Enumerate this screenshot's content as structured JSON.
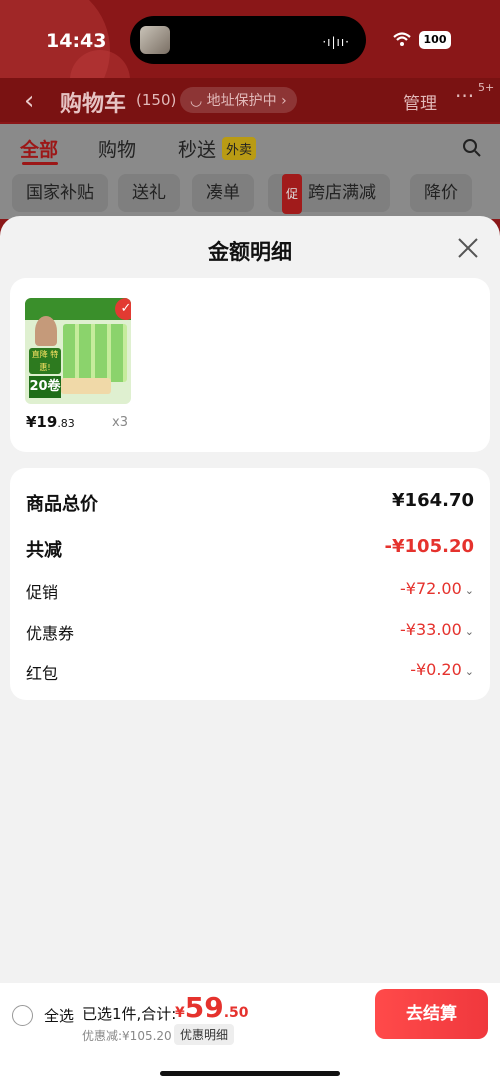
{
  "status_bar": {
    "time": "14:43",
    "battery": "100"
  },
  "nav": {
    "back_icon": "chevron-left-icon",
    "title": "购物车",
    "count": "(150)",
    "address": "地址保护中",
    "manage": "管理",
    "more_badge": "5+"
  },
  "tabs": {
    "all": "全部",
    "shopping": "购物",
    "flash": "秒送",
    "waimai": "外卖"
  },
  "chips": [
    "国家补贴",
    "送礼",
    "凑单",
    "跨店满减",
    "降价"
  ],
  "chip_promo_icon": "促",
  "sheet": {
    "title": "金额明细",
    "product": {
      "price_main": "¥19",
      "price_dec": ".83",
      "qty": "x3",
      "img_tag": "直降\n特惠!",
      "img_num": "20卷"
    },
    "rows": [
      {
        "label": "商品总价",
        "value": "¥164.70"
      },
      {
        "label": "共减",
        "value": "-¥105.20"
      },
      {
        "label": "促销",
        "value": "-¥72.00"
      },
      {
        "label": "优惠券",
        "value": "-¥33.00"
      },
      {
        "label": "红包",
        "value": "-¥0.20"
      }
    ]
  },
  "bottom_bar": {
    "select_all": "全选",
    "selected_info": "已选1件,合计:",
    "total_yen": "¥",
    "total_main": "59",
    "total_dec": ".50",
    "discount": "优惠减:¥105.20",
    "detail_button": "优惠明细",
    "checkout": "去结算"
  },
  "colors": {
    "accent_red": "#e5322d",
    "nav_bg_dim": "#8a1718"
  }
}
